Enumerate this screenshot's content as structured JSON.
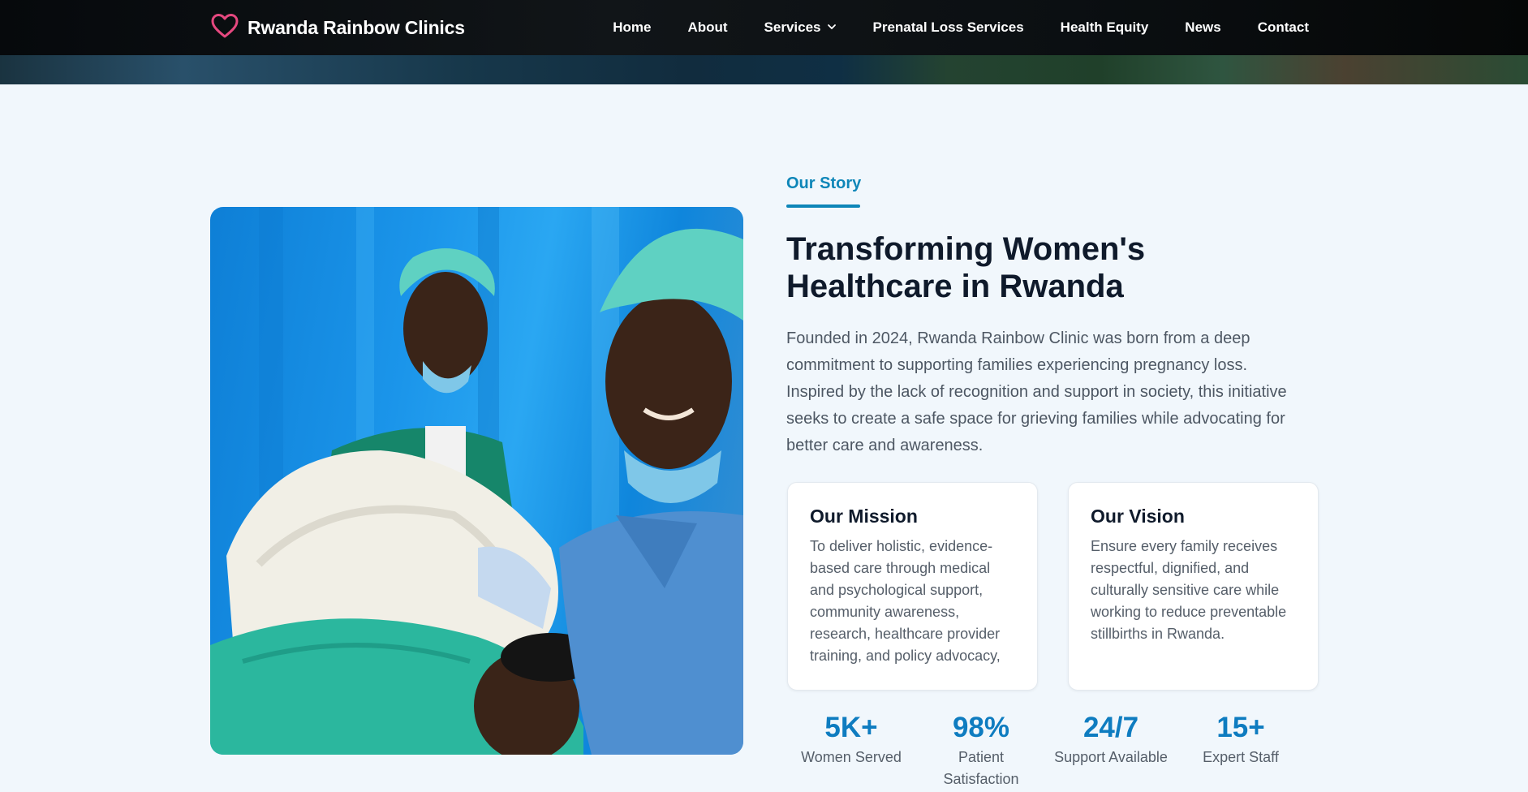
{
  "header": {
    "brand_name": "Rwanda Rainbow Clinics",
    "nav": [
      {
        "label": "Home"
      },
      {
        "label": "About"
      },
      {
        "label": "Services",
        "has_dropdown": true
      },
      {
        "label": "Prenatal Loss Services"
      },
      {
        "label": "Health Equity"
      },
      {
        "label": "News"
      },
      {
        "label": "Contact"
      }
    ]
  },
  "story": {
    "kicker": "Our Story",
    "headline": "Transforming Women's Healthcare in Rwanda",
    "intro": "Founded in 2024, Rwanda Rainbow Clinic was born from a deep commitment to supporting families experiencing pregnancy loss. Inspired by the lack of recognition and support in society, this initiative seeks to create a safe space for grieving families while advocating for better care and awareness.",
    "mission": {
      "title": "Our Mission",
      "text": "To deliver holistic, evidence-based care through medical and psychological support, community awareness, research, healthcare provider training, and policy advocacy,"
    },
    "vision": {
      "title": "Our Vision",
      "text": "Ensure every family receives respectful, dignified, and culturally sensitive care while working to reduce preventable stillbirths in Rwanda."
    },
    "stats": [
      {
        "value": "5K+",
        "label": "Women Served"
      },
      {
        "value": "98%",
        "label": "Patient Satisfaction"
      },
      {
        "value": "24/7",
        "label": "Support Available"
      },
      {
        "value": "15+",
        "label": "Expert Staff"
      }
    ]
  },
  "colors": {
    "accent": "#0e86b8",
    "stat_blue": "#0e7cc0",
    "heart_pink": "#e5487f",
    "heading": "#0f1a2b"
  },
  "icons": {
    "brand": "heart-outline-icon",
    "dropdown": "chevron-down-icon"
  }
}
